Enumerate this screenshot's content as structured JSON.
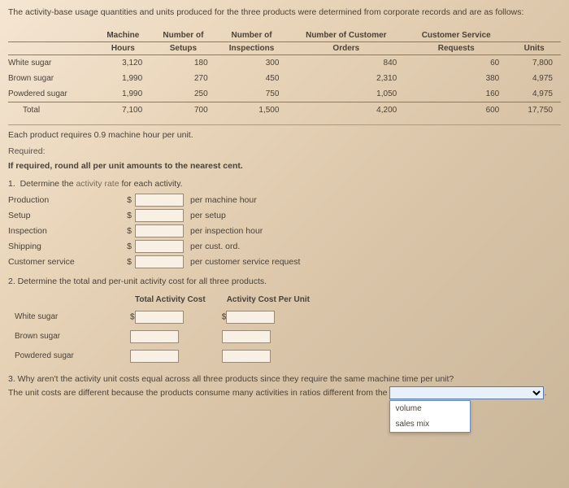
{
  "intro": "The activity-base usage quantities and units produced for the three products were determined from corporate records and are as follows:",
  "table": {
    "headers1": [
      "",
      "Machine",
      "Number of",
      "Number of",
      "Number of Customer",
      "Customer Service",
      ""
    ],
    "headers2": [
      "",
      "Hours",
      "Setups",
      "Inspections",
      "Orders",
      "Requests",
      "Units"
    ],
    "rows": [
      {
        "name": "White sugar",
        "vals": [
          "3,120",
          "180",
          "300",
          "840",
          "60",
          "7,800"
        ]
      },
      {
        "name": "Brown sugar",
        "vals": [
          "1,990",
          "270",
          "450",
          "2,310",
          "380",
          "4,975"
        ]
      },
      {
        "name": "Powdered sugar",
        "vals": [
          "1,990",
          "250",
          "750",
          "1,050",
          "160",
          "4,975"
        ]
      }
    ],
    "total": {
      "name": "Total",
      "vals": [
        "7,100",
        "700",
        "1,500",
        "4,200",
        "600",
        "17,750"
      ]
    }
  },
  "note": "Each product requires 0.9 machine hour per unit.",
  "required_label": "Required:",
  "required_text": "If required, round all per unit amounts to the nearest cent.",
  "q1_text": "1.  Determine the activity rate for each activity.",
  "activities": [
    {
      "name": "Production",
      "per": "per machine hour"
    },
    {
      "name": "Setup",
      "per": "per setup"
    },
    {
      "name": "Inspection",
      "per": "per inspection hour"
    },
    {
      "name": "Shipping",
      "per": "per cust. ord."
    },
    {
      "name": "Customer service",
      "per": "per customer service request"
    }
  ],
  "q2_text": "2.  Determine the total and per-unit activity cost for all three products.",
  "costs": {
    "h1": "Total Activity Cost",
    "h2": "Activity Cost Per Unit",
    "rows": [
      "White sugar",
      "Brown sugar",
      "Powdered sugar"
    ]
  },
  "q3_line1": "3.  Why aren't the activity unit costs equal across all three products since they require the same machine time per unit?",
  "q3_line2_a": "The unit costs are different because the products consume many activities in ratios different from the ",
  "dropdown": {
    "opt1": "volume",
    "opt2": "sales mix"
  }
}
